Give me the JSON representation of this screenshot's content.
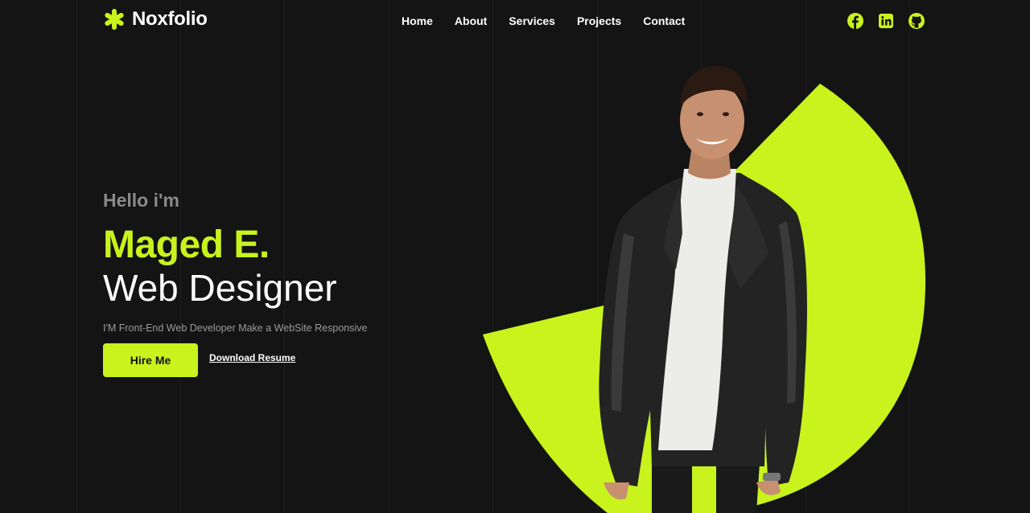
{
  "brand": {
    "name": "Noxfolio",
    "icon": "asterisk-logo-icon",
    "accent": "#c8f31d"
  },
  "nav": {
    "items": [
      "Home",
      "About",
      "Services",
      "Projects",
      "Contact"
    ]
  },
  "socials": [
    {
      "name": "facebook",
      "icon": "facebook-icon"
    },
    {
      "name": "linkedin",
      "icon": "linkedin-icon"
    },
    {
      "name": "github",
      "icon": "github-icon"
    }
  ],
  "hero": {
    "greeting": "Hello i'm",
    "name": "Maged E.",
    "role": "Web Designer",
    "tagline": "I'M Front-End Web Developer Make a WebSite Responsive",
    "primary_cta": "Hire Me",
    "secondary_cta": "Download Resume"
  },
  "colors": {
    "background": "#141414",
    "accent": "#c8f31d",
    "muted": "#8a8a8a"
  }
}
